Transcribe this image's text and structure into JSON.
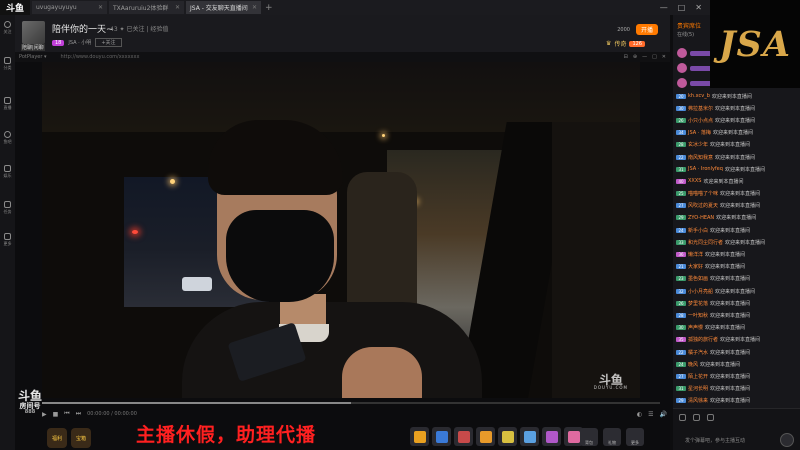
{
  "app": {
    "logo_text": "斗鱼",
    "tabs": [
      {
        "label": "uvugayuyuyu",
        "active": false
      },
      {
        "label": "TXAaruruiu2体验群",
        "active": false
      },
      {
        "label": "JSA - 交友聊天直播间",
        "active": true
      }
    ],
    "new_tab": "+",
    "window_controls": [
      "—",
      "□",
      "✕"
    ]
  },
  "leftnav": [
    {
      "label": "关注",
      "icon": "heart-icon"
    },
    {
      "label": "分类",
      "icon": "grid-icon"
    },
    {
      "label": "直播",
      "icon": "tv-icon"
    },
    {
      "label": "鱼吧",
      "icon": "fish-icon"
    },
    {
      "label": "娱乐",
      "icon": "star-icon"
    },
    {
      "label": "任务",
      "icon": "task-icon"
    },
    {
      "label": "更多",
      "icon": "more-icon"
    }
  ],
  "room": {
    "avatar_caption": "陪聊|闲聊",
    "title": "陪伴你的一天~",
    "meta": "43  ✦ 已关注 | 经验值",
    "tags": [
      "JSA · 小明",
      "关注主播"
    ],
    "badge": "18",
    "follow_label": "+关注",
    "header_right": {
      "count": "2000",
      "button": "开播"
    },
    "rank": {
      "label": "传奇",
      "level": "126"
    }
  },
  "player": {
    "source": "PotPlayer ▾",
    "url": "http://www.douyu.com/xxxxxxx",
    "controls": [
      "⊟",
      "⊕",
      "—",
      "□",
      "✕"
    ]
  },
  "video": {
    "watermark": "斗鱼",
    "watermark_sub": "DOUYU.COM"
  },
  "progress": {
    "fraction": 0.5
  },
  "controls": {
    "play": "▶",
    "stop": "■",
    "prev": "⏮",
    "next": "⏭",
    "time": "00:00:00 / 00:00:00",
    "right_icons": [
      "◐",
      "☰",
      "🔊"
    ]
  },
  "station": {
    "logo": "斗鱼",
    "tag": "房间号",
    "num": "888"
  },
  "mini_icons": [
    "福利",
    "宝箱"
  ],
  "banner": {
    "text": "主播休假，助理代播",
    "color": "#ff2020"
  },
  "gifts": [
    {
      "color": "#e8a020"
    },
    {
      "color": "#3a7ad8"
    },
    {
      "color": "#c84a4a"
    },
    {
      "color": "#e89a2a"
    },
    {
      "color": "#d8c040"
    },
    {
      "color": "#5aa0e0"
    },
    {
      "color": "#b058c8"
    },
    {
      "color": "#e06aa0"
    }
  ],
  "gifts_right": [
    "背包",
    "礼物",
    "更多"
  ],
  "chat": {
    "header_title": "贵宾席位",
    "header_sub": "在线(5)",
    "messages": [
      {
        "lv": "20",
        "lv_color": "#4a8ad8",
        "user": "kh.xcv_b",
        "text": "欢迎来到本直播间"
      },
      {
        "lv": "30",
        "lv_color": "#4a8ad8",
        "user": "弗拉基米尔",
        "text": "欢迎来到本直播间"
      },
      {
        "lv": "26",
        "lv_color": "#3a9a6a",
        "user": "小只小点点",
        "text": "欢迎来到本直播间"
      },
      {
        "lv": "34",
        "lv_color": "#4a8ad8",
        "user": "JSA · 落梅",
        "text": "欢迎来到本直播间"
      },
      {
        "lv": "28",
        "lv_color": "#3a9a6a",
        "user": "玄冰少年",
        "text": "欢迎来到本直播间"
      },
      {
        "lv": "22",
        "lv_color": "#4a8ad8",
        "user": "南风知我意",
        "text": "欢迎来到本直播间"
      },
      {
        "lv": "31",
        "lv_color": "#3a9a6a",
        "user": "JSA · Ironlyfeq",
        "text": "欢迎来到本直播间"
      },
      {
        "lv": "40",
        "lv_color": "#c05ac8",
        "user": "XXXS",
        "text": "欢迎来到本直播间"
      },
      {
        "lv": "25",
        "lv_color": "#3a9a6a",
        "user": "喵喵喵了个咪",
        "text": "欢迎来到本直播间"
      },
      {
        "lv": "27",
        "lv_color": "#4a8ad8",
        "user": "风吹过的夏天",
        "text": "欢迎来到本直播间"
      },
      {
        "lv": "29",
        "lv_color": "#3a9a6a",
        "user": "ZYO-HEAN",
        "text": "欢迎来到本直播间"
      },
      {
        "lv": "24",
        "lv_color": "#4a8ad8",
        "user": "新手小白",
        "text": "欢迎来到本直播间"
      },
      {
        "lv": "33",
        "lv_color": "#3a9a6a",
        "user": "和光同尘同行者",
        "text": "欢迎来到本直播间"
      },
      {
        "lv": "36",
        "lv_color": "#c05ac8",
        "user": "懒洋洋",
        "text": "欢迎来到本直播间"
      },
      {
        "lv": "21",
        "lv_color": "#4a8ad8",
        "user": "大家好",
        "text": "欢迎来到本直播间"
      },
      {
        "lv": "23",
        "lv_color": "#3a9a6a",
        "user": "墨色如画",
        "text": "欢迎来到本直播间"
      },
      {
        "lv": "32",
        "lv_color": "#4a8ad8",
        "user": "小小月亮船",
        "text": "欢迎来到本直播间"
      },
      {
        "lv": "26",
        "lv_color": "#3a9a6a",
        "user": "梦里花落",
        "text": "欢迎来到本直播间"
      },
      {
        "lv": "28",
        "lv_color": "#4a8ad8",
        "user": "一叶知秋",
        "text": "欢迎来到本直播间"
      },
      {
        "lv": "30",
        "lv_color": "#3a9a6a",
        "user": "声声慢",
        "text": "欢迎来到本直播间"
      },
      {
        "lv": "35",
        "lv_color": "#c05ac8",
        "user": "孤独的旅行者",
        "text": "欢迎来到本直播间"
      },
      {
        "lv": "22",
        "lv_color": "#4a8ad8",
        "user": "橘子汽水",
        "text": "欢迎来到本直播间"
      },
      {
        "lv": "24",
        "lv_color": "#3a9a6a",
        "user": "晚风",
        "text": "欢迎来到本直播间"
      },
      {
        "lv": "27",
        "lv_color": "#4a8ad8",
        "user": "陌上花开",
        "text": "欢迎来到本直播间"
      },
      {
        "lv": "31",
        "lv_color": "#3a9a6a",
        "user": "星河长明",
        "text": "欢迎来到本直播间"
      },
      {
        "lv": "29",
        "lv_color": "#4a8ad8",
        "user": "清风徐来",
        "text": "欢迎来到本直播间"
      }
    ],
    "input_hint": "发个弹幕吧，参与主播互动"
  },
  "jsa_logo": "JSA"
}
